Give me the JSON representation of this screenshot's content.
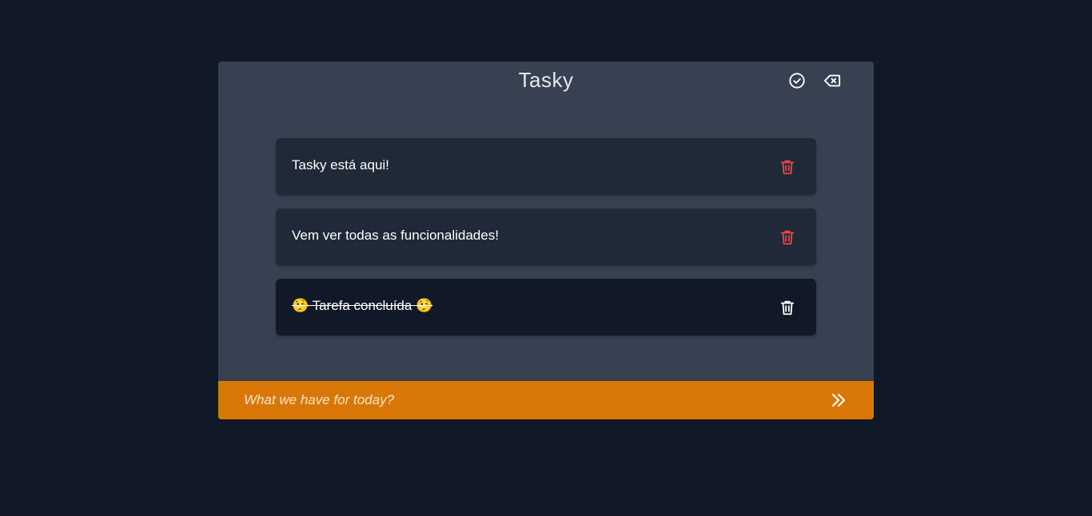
{
  "app": {
    "title": "Tasky"
  },
  "header": {
    "complete_all_icon": "check-circle-icon",
    "clear_icon": "backspace-icon"
  },
  "tasks": [
    {
      "text": "Tasky está aqui!",
      "done": false,
      "trash_color": "#ef4444"
    },
    {
      "text": "Vem ver todas as funcionalidades!",
      "done": false,
      "trash_color": "#ef4444"
    },
    {
      "text": "🤥 Tarefa concluída 🤥",
      "done": true,
      "trash_color": "#ffffff"
    }
  ],
  "input": {
    "placeholder": "What we have for today?",
    "value": ""
  },
  "colors": {
    "background": "#111827",
    "panel": "#374151",
    "task": "#1f2937",
    "task_done": "#111827",
    "accent": "#d97706",
    "danger": "#ef4444"
  }
}
